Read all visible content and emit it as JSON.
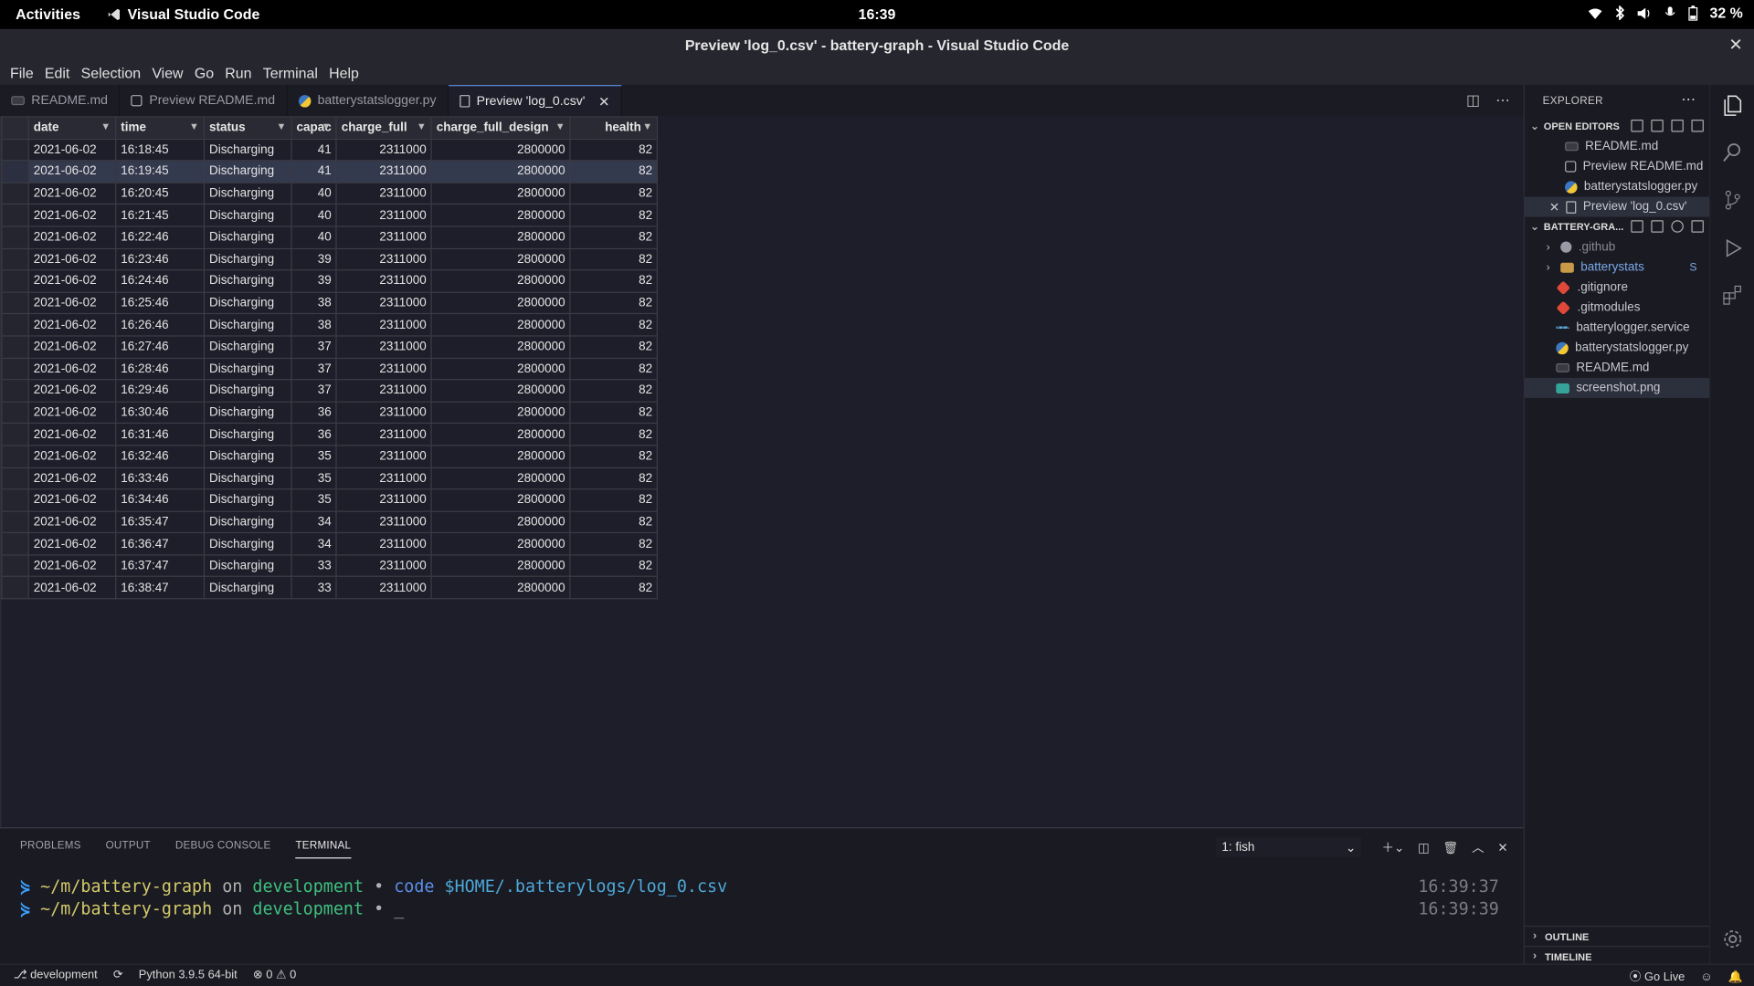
{
  "system_bar": {
    "activities": "Activities",
    "app_name": "Visual Studio Code",
    "clock": "16:39",
    "battery": "32 %"
  },
  "window": {
    "title": "Preview 'log_0.csv' - battery-graph - Visual Studio Code"
  },
  "menu": [
    "File",
    "Edit",
    "Selection",
    "View",
    "Go",
    "Run",
    "Terminal",
    "Help"
  ],
  "tabs": [
    {
      "label": "README.md",
      "icon": "markdown-icon"
    },
    {
      "label": "Preview README.md",
      "icon": "preview-icon"
    },
    {
      "label": "batterystatslogger.py",
      "icon": "python-icon"
    },
    {
      "label": "Preview 'log_0.csv'",
      "icon": "file-icon",
      "active": true
    }
  ],
  "grid": {
    "headers": [
      "date",
      "time",
      "status",
      "capac",
      "charge_full",
      "charge_full_design",
      "health"
    ],
    "rows": [
      [
        "2021-06-02",
        "16:18:45",
        "Discharging",
        "41",
        "2311000",
        "2800000",
        "82"
      ],
      [
        "2021-06-02",
        "16:19:45",
        "Discharging",
        "41",
        "2311000",
        "2800000",
        "82"
      ],
      [
        "2021-06-02",
        "16:20:45",
        "Discharging",
        "40",
        "2311000",
        "2800000",
        "82"
      ],
      [
        "2021-06-02",
        "16:21:45",
        "Discharging",
        "40",
        "2311000",
        "2800000",
        "82"
      ],
      [
        "2021-06-02",
        "16:22:46",
        "Discharging",
        "40",
        "2311000",
        "2800000",
        "82"
      ],
      [
        "2021-06-02",
        "16:23:46",
        "Discharging",
        "39",
        "2311000",
        "2800000",
        "82"
      ],
      [
        "2021-06-02",
        "16:24:46",
        "Discharging",
        "39",
        "2311000",
        "2800000",
        "82"
      ],
      [
        "2021-06-02",
        "16:25:46",
        "Discharging",
        "38",
        "2311000",
        "2800000",
        "82"
      ],
      [
        "2021-06-02",
        "16:26:46",
        "Discharging",
        "38",
        "2311000",
        "2800000",
        "82"
      ],
      [
        "2021-06-02",
        "16:27:46",
        "Discharging",
        "37",
        "2311000",
        "2800000",
        "82"
      ],
      [
        "2021-06-02",
        "16:28:46",
        "Discharging",
        "37",
        "2311000",
        "2800000",
        "82"
      ],
      [
        "2021-06-02",
        "16:29:46",
        "Discharging",
        "37",
        "2311000",
        "2800000",
        "82"
      ],
      [
        "2021-06-02",
        "16:30:46",
        "Discharging",
        "36",
        "2311000",
        "2800000",
        "82"
      ],
      [
        "2021-06-02",
        "16:31:46",
        "Discharging",
        "36",
        "2311000",
        "2800000",
        "82"
      ],
      [
        "2021-06-02",
        "16:32:46",
        "Discharging",
        "35",
        "2311000",
        "2800000",
        "82"
      ],
      [
        "2021-06-02",
        "16:33:46",
        "Discharging",
        "35",
        "2311000",
        "2800000",
        "82"
      ],
      [
        "2021-06-02",
        "16:34:46",
        "Discharging",
        "35",
        "2311000",
        "2800000",
        "82"
      ],
      [
        "2021-06-02",
        "16:35:47",
        "Discharging",
        "34",
        "2311000",
        "2800000",
        "82"
      ],
      [
        "2021-06-02",
        "16:36:47",
        "Discharging",
        "34",
        "2311000",
        "2800000",
        "82"
      ],
      [
        "2021-06-02",
        "16:37:47",
        "Discharging",
        "33",
        "2311000",
        "2800000",
        "82"
      ],
      [
        "2021-06-02",
        "16:38:47",
        "Discharging",
        "33",
        "2311000",
        "2800000",
        "82"
      ]
    ]
  },
  "panel": {
    "tabs": [
      "PROBLEMS",
      "OUTPUT",
      "DEBUG CONSOLE",
      "TERMINAL"
    ],
    "active_tab": "TERMINAL",
    "shell": "1: fish",
    "lines": [
      {
        "path": "~/m/battery-graph",
        "on": "on",
        "branch": "development",
        "dot": "•",
        "cmd": "code",
        "arg": "$HOME/.batterylogs/log_0.csv",
        "cursor": "",
        "time": "16:39:37"
      },
      {
        "path": "~/m/battery-graph",
        "on": "on",
        "branch": "development",
        "dot": "•",
        "cmd": "",
        "arg": "",
        "cursor": "_",
        "time": "16:39:39"
      }
    ]
  },
  "explorer": {
    "title": "EXPLORER",
    "open_editors_label": "OPEN EDITORS",
    "open_editors": [
      {
        "label": "README.md",
        "icon": "markdown-icon"
      },
      {
        "label": "Preview README.md",
        "icon": "preview-icon"
      },
      {
        "label": "batterystatslogger.py",
        "icon": "python-icon"
      },
      {
        "label": "Preview 'log_0.csv'",
        "icon": "file-icon",
        "close": "✕"
      }
    ],
    "project_label": "BATTERY-GRA...",
    "files": [
      {
        "label": ".github",
        "icon": "github-icon",
        "folder": true
      },
      {
        "label": "batterystats",
        "icon": "folder-icon",
        "folder": true,
        "badge": "S"
      },
      {
        "label": ".gitignore",
        "icon": "git-icon"
      },
      {
        "label": ".gitmodules",
        "icon": "git-icon"
      },
      {
        "label": "batterylogger.service",
        "icon": "service-icon"
      },
      {
        "label": "batterystatslogger.py",
        "icon": "python-icon"
      },
      {
        "label": "README.md",
        "icon": "markdown-icon"
      },
      {
        "label": "screenshot.png",
        "icon": "image-icon",
        "selected": true
      }
    ],
    "outline_label": "OUTLINE",
    "timeline_label": "TIMELINE"
  },
  "status": {
    "branch": "development",
    "python": "Python 3.9.5 64-bit",
    "errors": "0",
    "warnings": "0",
    "go_live": "Go Live"
  },
  "colors": {
    "accent": "#5a8ad6",
    "background": "#1e1e2a",
    "prompt_arrow": "#3aa0ff",
    "branch": "#3fbf7f"
  }
}
